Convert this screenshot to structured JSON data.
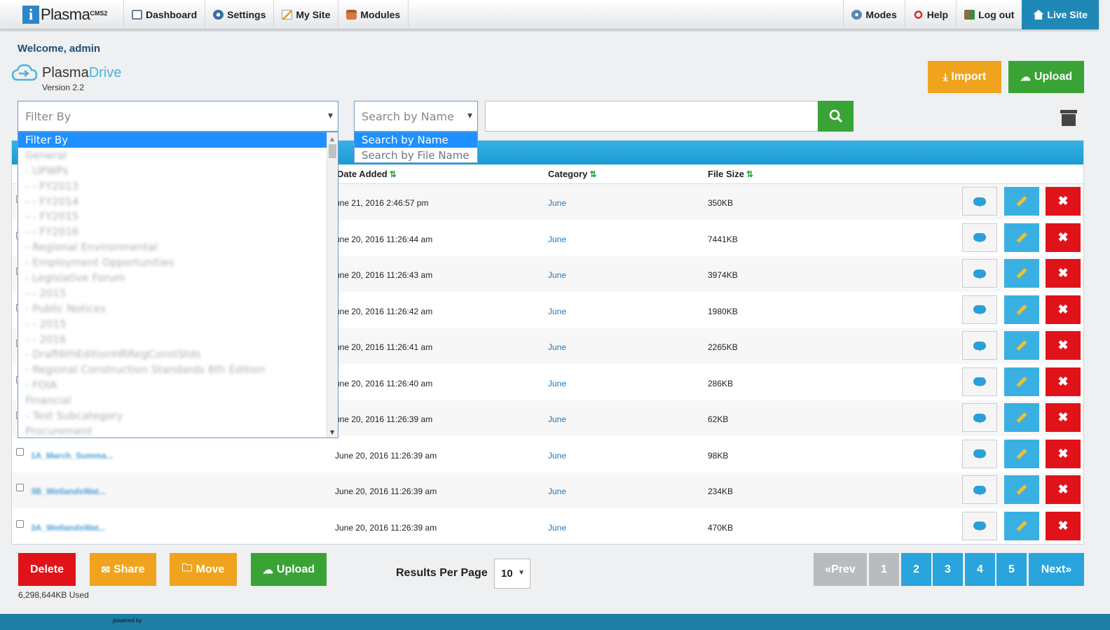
{
  "topbar": {
    "logo_text": "Plasma",
    "logo_sup": "CMS2",
    "nav_left": [
      {
        "label": "Dashboard",
        "icon": "dashboard-icon"
      },
      {
        "label": "Settings",
        "icon": "gear-icon"
      },
      {
        "label": "My Site",
        "icon": "pencil-icon"
      },
      {
        "label": "Modules",
        "icon": "box-icon"
      }
    ],
    "nav_right": [
      {
        "label": "Modes",
        "icon": "gears-icon"
      },
      {
        "label": "Help",
        "icon": "help-icon"
      },
      {
        "label": "Log out",
        "icon": "logout-icon"
      },
      {
        "label": "Live Site",
        "icon": "home-icon"
      }
    ]
  },
  "welcome": "Welcome, admin",
  "drive": {
    "name_a": "Plasma",
    "name_b": "Drive",
    "version": "Version 2.2"
  },
  "buttons": {
    "import": "Import",
    "upload": "Upload"
  },
  "filter": {
    "placeholder": "Filter By",
    "options": [
      "Filter By",
      "General",
      "- UPWPs",
      "- - FY2013",
      "- - FY2014",
      "- - FY2015",
      "- - FY2016",
      "- Regional Environmental",
      "- Employment Opportunities",
      "- Legislative Forum",
      "- - 2015",
      "- Public Notices",
      "- - 2015",
      "- - 2016",
      "- Draft6thEditionHRRegConstStds",
      "- Regional Construction Standards 6th Edition",
      "- FOIA",
      "Financial",
      "- Test Subcategory",
      "Procurement"
    ]
  },
  "search_mode": {
    "selected": "Search by Name",
    "options": [
      "Search by Name",
      "Search by File Name"
    ]
  },
  "table": {
    "headers": {
      "date": "Date Added",
      "category": "Category",
      "size": "File Size"
    },
    "rows": [
      {
        "name": "",
        "date": "une 21, 2016 2:46:57 pm",
        "category": "June",
        "size": "350KB"
      },
      {
        "name": "",
        "date": "une 20, 2016 11:26:44 am",
        "category": "June",
        "size": "7441KB"
      },
      {
        "name": "",
        "date": "une 20, 2016 11:26:43 am",
        "category": "June",
        "size": "3974KB"
      },
      {
        "name": "",
        "date": "une 20, 2016 11:26:42 am",
        "category": "June",
        "size": "1980KB"
      },
      {
        "name": "",
        "date": "une 20, 2016 11:26:41 am",
        "category": "June",
        "size": "2265KB"
      },
      {
        "name": "",
        "date": "une 20, 2016 11:26:40 am",
        "category": "June",
        "size": "286KB"
      },
      {
        "name": "",
        "date": "une 20, 2016 11:26:39 am",
        "category": "June",
        "size": "62KB"
      },
      {
        "name": "1A_March_Summa...",
        "date": "June 20, 2016 11:26:39 am",
        "category": "June",
        "size": "98KB"
      },
      {
        "name": "3B_WetlandsWat...",
        "date": "June 20, 2016 11:26:39 am",
        "category": "June",
        "size": "234KB"
      },
      {
        "name": "3A_WetlandsWat...",
        "date": "June 20, 2016 11:26:39 am",
        "category": "June",
        "size": "470KB"
      }
    ]
  },
  "bottom": {
    "delete": "Delete",
    "share": "Share",
    "move": "Move",
    "upload": "Upload",
    "used": "6,298,644KB Used",
    "rpp_label": "Results Per Page",
    "rpp_value": "10"
  },
  "pagination": {
    "prev": "«Prev",
    "pages": [
      "1",
      "2",
      "3",
      "4",
      "5"
    ],
    "next": "Next»"
  },
  "footer": {
    "powered": "powered by"
  },
  "colors": {
    "brand_blue": "#1f88b7",
    "green": "#3aa335",
    "orange": "#f0a31e",
    "red": "#e0131a",
    "page_blue": "#29a4dc"
  }
}
